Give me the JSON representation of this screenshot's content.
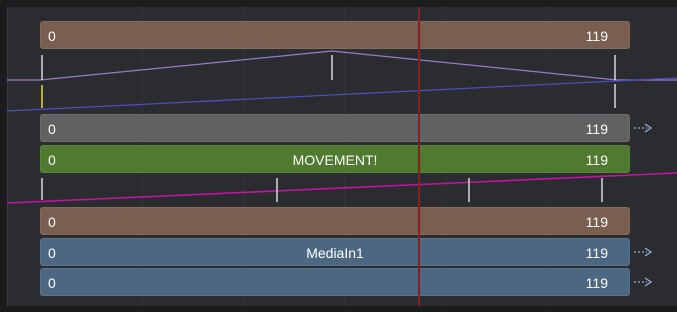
{
  "colors": {
    "background": "#1b1c1e",
    "panel": "#2b2c30",
    "bar_brown": "#7a5e4f",
    "bar_gray": "#5f6163",
    "bar_green": "#4f7a2f",
    "bar_blue": "#4d6783",
    "playhead": "#8b1e1e",
    "curve_lavender": "#9a78c8",
    "curve_blue": "#4c4ec4",
    "curve_magenta": "#c0169f",
    "arrow": "#8fb2d8"
  },
  "tracks": [
    {
      "start": "0",
      "end": "119",
      "name": "",
      "arrow": false
    },
    {
      "start": "0",
      "end": "119",
      "name": "",
      "arrow": true
    },
    {
      "start": "0",
      "end": "119",
      "name": "MOVEMENT!",
      "arrow": false
    },
    {
      "start": "0",
      "end": "119",
      "name": "",
      "arrow": false
    },
    {
      "start": "0",
      "end": "119",
      "name": "MediaIn1",
      "arrow": true
    },
    {
      "start": "0",
      "end": "119",
      "name": "",
      "arrow": true
    }
  ],
  "icons": {
    "arrow": "dotted-right-arrow-icon",
    "keyframe": "keyframe-tick-icon"
  }
}
